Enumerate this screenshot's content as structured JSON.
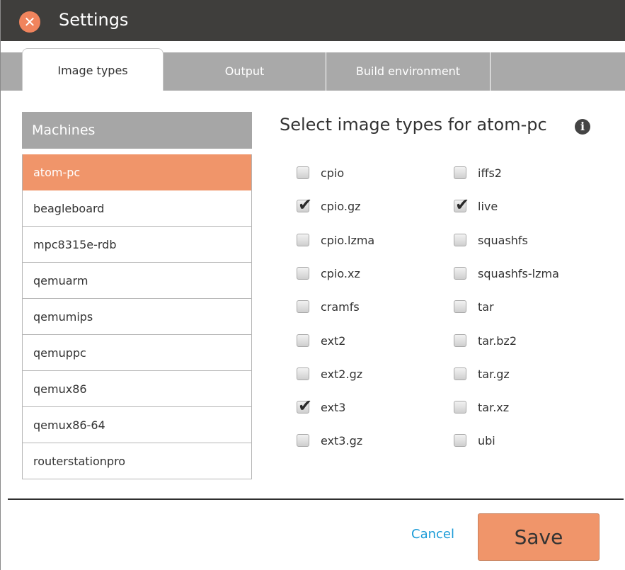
{
  "window": {
    "title": "Settings"
  },
  "tabs": [
    {
      "label": "Image types",
      "active": true
    },
    {
      "label": "Output",
      "active": false
    },
    {
      "label": "Build environment",
      "active": false
    }
  ],
  "machines": {
    "header": "Machines",
    "items": [
      {
        "label": "atom-pc",
        "selected": true
      },
      {
        "label": "beagleboard",
        "selected": false
      },
      {
        "label": "mpc8315e-rdb",
        "selected": false
      },
      {
        "label": "qemuarm",
        "selected": false
      },
      {
        "label": "qemumips",
        "selected": false
      },
      {
        "label": "qemuppc",
        "selected": false
      },
      {
        "label": "qemux86",
        "selected": false
      },
      {
        "label": "qemux86-64",
        "selected": false
      },
      {
        "label": "routerstationpro",
        "selected": false
      }
    ]
  },
  "image_types": {
    "heading": "Select image types for atom-pc",
    "left": [
      {
        "label": "cpio",
        "checked": false
      },
      {
        "label": "cpio.gz",
        "checked": true
      },
      {
        "label": "cpio.lzma",
        "checked": false
      },
      {
        "label": "cpio.xz",
        "checked": false
      },
      {
        "label": "cramfs",
        "checked": false
      },
      {
        "label": "ext2",
        "checked": false
      },
      {
        "label": "ext2.gz",
        "checked": false
      },
      {
        "label": "ext3",
        "checked": true
      },
      {
        "label": "ext3.gz",
        "checked": false
      }
    ],
    "right": [
      {
        "label": "iffs2",
        "checked": false
      },
      {
        "label": "live",
        "checked": true
      },
      {
        "label": "squashfs",
        "checked": false
      },
      {
        "label": "squashfs-lzma",
        "checked": false
      },
      {
        "label": "tar",
        "checked": false
      },
      {
        "label": "tar.bz2",
        "checked": false
      },
      {
        "label": "tar.gz",
        "checked": false
      },
      {
        "label": "tar.xz",
        "checked": false
      },
      {
        "label": "ubi",
        "checked": false
      }
    ]
  },
  "footer": {
    "cancel_label": "Cancel",
    "save_label": "Save"
  },
  "icons": {
    "close": "close-icon",
    "info": "info-icon",
    "check": "checkmark-icon"
  },
  "colors": {
    "accent": "#f0956a",
    "titlebar": "#3f3e3c",
    "link": "#1a9bd7",
    "tabstrip": "#a9a9a9"
  }
}
